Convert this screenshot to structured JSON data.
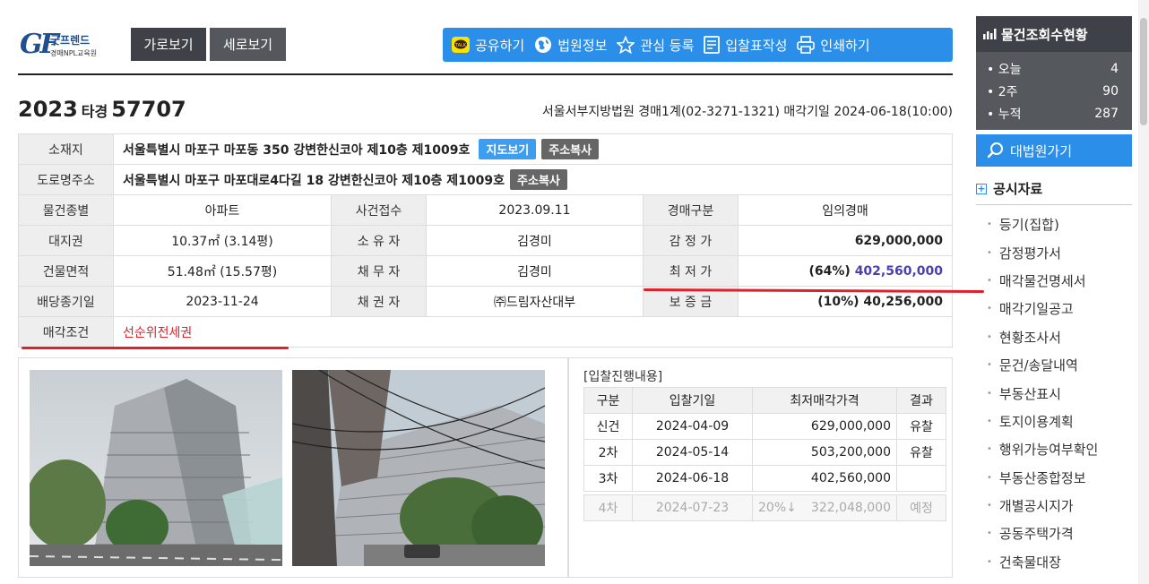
{
  "logo": {
    "mark": "GF",
    "name": "굿프렌드",
    "sub": "경매NPL교육원"
  },
  "view": {
    "horizontal": "가로보기",
    "vertical": "세로보기"
  },
  "toolbar": [
    {
      "icon": "kakao-talk-icon",
      "label": "공유하기"
    },
    {
      "icon": "globe-icon",
      "label": "법원정보"
    },
    {
      "icon": "star-icon",
      "label": "관심 등록"
    },
    {
      "icon": "document-icon",
      "label": "입찰표작성"
    },
    {
      "icon": "printer-icon",
      "label": "인쇄하기"
    }
  ],
  "case": {
    "year": "2023",
    "type": "타경",
    "number": "57707"
  },
  "court_line": "서울서부지방법원 경매1계(02-3271-1321) 매각기일 2024-06-18(10:00)",
  "info": {
    "location_label": "소재지",
    "location": "서울특별시 마포구 마포동 350 강변한신코아 제10층 제1009호",
    "map_btn": "지도보기",
    "copy_btn": "주소복사",
    "road_label": "도로명주소",
    "road": "서울특별시 마포구 마포대로4다길 18 강변한신코아 제10층 제1009호",
    "copy_btn2": "주소복사",
    "type_label": "물건종별",
    "type": "아파트",
    "receipt_label": "사건접수",
    "receipt": "2023.09.11",
    "auction_kind_label": "경매구분",
    "auction_kind": "임의경매",
    "land_label": "대지권",
    "land": "10.37㎡ (3.14평)",
    "owner_label": "소 유 자",
    "owner": "김경미",
    "appraisal_label": "감 정 가",
    "appraisal": "629,000,000",
    "building_label": "건물면적",
    "building": "51.48㎡ (15.57평)",
    "debtor_label": "채 무 자",
    "debtor": "김경미",
    "min_label": "최 저 가",
    "min_pct": "(64%)",
    "min": "402,560,000",
    "dividend_label": "배당종기일",
    "dividend": "2023-11-24",
    "creditor_label": "채 권 자",
    "creditor": "㈜드림자산대부",
    "deposit_label": "보 증 금",
    "deposit": "(10%) 40,256,000",
    "condition_label": "매각조건",
    "condition": "선순위전세권"
  },
  "bid": {
    "title": "[입찰진행내용]",
    "headers": [
      "구분",
      "입찰기일",
      "최저매각가격",
      "결과"
    ],
    "rows": [
      [
        "신건",
        "2024-04-09",
        "629,000,000",
        "유찰"
      ],
      [
        "2차",
        "2024-05-14",
        "503,200,000",
        "유찰"
      ],
      [
        "3차",
        "2024-06-18",
        "402,560,000",
        ""
      ]
    ],
    "future": {
      "round": "4차",
      "date": "2024-07-23",
      "pct": "20%↓",
      "price": "322,048,000",
      "result": "예정"
    }
  },
  "sidebar": {
    "title": "물건조회수현황",
    "stats": [
      {
        "label": "• 오늘",
        "value": "4"
      },
      {
        "label": "• 2주",
        "value": "90"
      },
      {
        "label": "• 누적",
        "value": "287"
      }
    ],
    "court_btn": "대법원가기",
    "public_title": "공시자료",
    "docs": [
      "등기(집합)",
      "감정평가서",
      "매각물건명세서",
      "매각기일공고",
      "현황조사서",
      "문건/송달내역",
      "부동산표시",
      "토지이용계획",
      "행위가능여부확인",
      "부동산종합정보",
      "개별공시지가",
      "공동주택가격",
      "건축물대장"
    ]
  },
  "colors": {
    "accent": "#2b8ee8",
    "dark": "#3e4147",
    "highlight": "#d9242c",
    "price": "#4a3fb5"
  }
}
